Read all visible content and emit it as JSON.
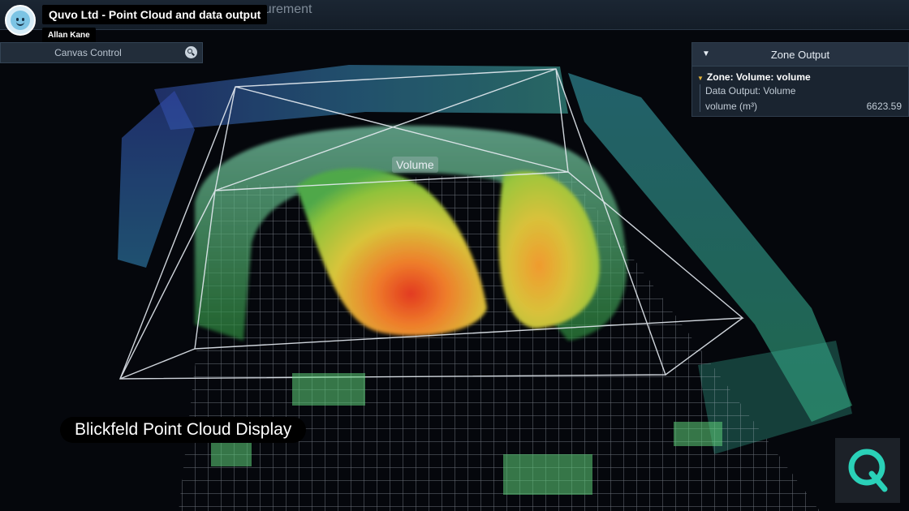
{
  "app": {
    "title_fragment": "easurement"
  },
  "video": {
    "title": "Quvo Ltd - Point Cloud and data output",
    "author": "Allan Kane",
    "caption": "Blickfeld Point Cloud Display"
  },
  "canvas_control": {
    "label": "Canvas Control",
    "icon": "search-icon"
  },
  "zone_output": {
    "title": "Zone Output",
    "zone_name": "Zone: Volume: volume",
    "data_output": "Data Output: Volume",
    "metric_label": "volume (m³)",
    "metric_value": "6623.59"
  },
  "scene": {
    "volume_label": "Volume"
  },
  "brand": {
    "logo_icon": "quvo-q-logo-icon",
    "accent": "#2ad1b8"
  }
}
